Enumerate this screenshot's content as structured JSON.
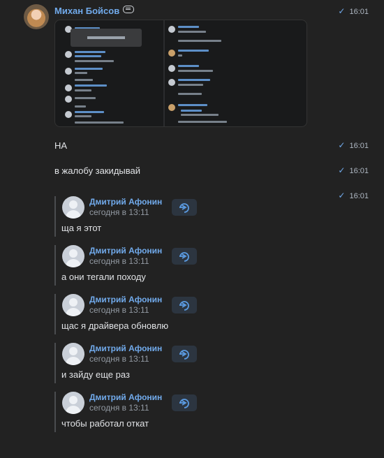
{
  "message": {
    "author": "Михан Бойсов",
    "author_badge": "status-emoji",
    "avatar": "user-avatar-blonde",
    "time_main": "16:01",
    "attachment": "screenshot-thumbnail"
  },
  "lines": [
    {
      "text": "НА",
      "time": "16:01"
    },
    {
      "text": "в жалобу закидывай",
      "time": "16:01"
    }
  ],
  "forward_time": "16:01",
  "forwarded": [
    {
      "name": "Дмитрий Афонин",
      "date": "сегодня в 13:11",
      "text": "ща я этот"
    },
    {
      "name": "Дмитрий Афонин",
      "date": "сегодня в 13:11",
      "text": "а они тегали походу"
    },
    {
      "name": "Дмитрий Афонин",
      "date": "сегодня в 13:11",
      "text": "щас я драйвера обновлю"
    },
    {
      "name": "Дмитрий Афонин",
      "date": "сегодня в 13:11",
      "text": "и зайду еще раз"
    },
    {
      "name": "Дмитрий Афонин",
      "date": "сегодня в 13:11",
      "text": "чтобы работал откат"
    }
  ],
  "icons": {
    "check": "check-icon",
    "share": "share-arrow-icon"
  },
  "colors": {
    "accent": "#71aaeb",
    "background": "#222222",
    "text": "#e1e3e6",
    "muted": "#939aa3"
  }
}
